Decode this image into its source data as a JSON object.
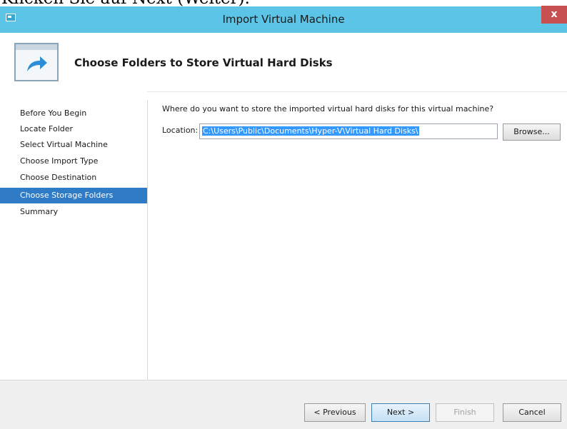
{
  "caption": "Klicken Sie auf Next (Weiter).",
  "window": {
    "title": "Import Virtual Machine",
    "close_label": "x"
  },
  "header": {
    "title": "Choose Folders to Store Virtual Hard Disks",
    "icon": "wizard-arrow-icon"
  },
  "nav": {
    "items": [
      {
        "label": "Before You Begin",
        "selected": false
      },
      {
        "label": "Locate Folder",
        "selected": false
      },
      {
        "label": "Select Virtual Machine",
        "selected": false
      },
      {
        "label": "Choose Import Type",
        "selected": false
      },
      {
        "label": "Choose Destination",
        "selected": false
      },
      {
        "label": "Choose Storage Folders",
        "selected": true
      },
      {
        "label": "Summary",
        "selected": false
      }
    ]
  },
  "content": {
    "prompt": "Where do you want to store the imported virtual hard disks for this virtual machine?",
    "location_label": "Location:",
    "location_value": "C:\\Users\\Public\\Documents\\Hyper-V\\Virtual Hard Disks\\",
    "browse_label": "Browse..."
  },
  "footer": {
    "previous_label": "< Previous",
    "next_label": "Next >",
    "finish_label": "Finish",
    "cancel_label": "Cancel"
  },
  "colors": {
    "titlebar": "#5cc4e6",
    "selection": "#2f7bc6",
    "close": "#c75050"
  }
}
